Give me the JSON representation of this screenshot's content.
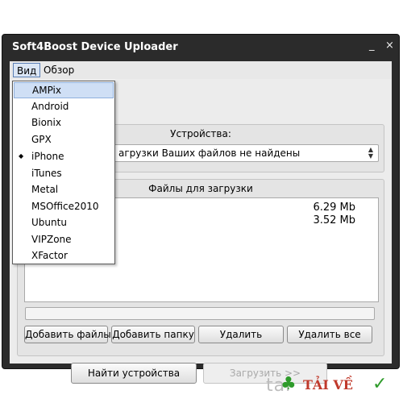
{
  "window": {
    "title": "Soft4Boost Device Uploader",
    "minimize_glyph": "_",
    "close_glyph": "×"
  },
  "menubar": {
    "items": [
      {
        "label": "Вид",
        "active": true
      },
      {
        "label": "Обзор",
        "active": false
      }
    ]
  },
  "devices_panel": {
    "header": "Устройства:",
    "select_value": "агрузки Ваших файлов не найдены"
  },
  "files_panel": {
    "header": "Файлы для загрузки",
    "file_sizes": [
      "6.29 Mb",
      "3.52 Mb"
    ],
    "progress": 0
  },
  "buttons": {
    "add_files": "Добавить файлы",
    "add_folder": "Добавить папку",
    "delete": "Удалить",
    "delete_all": "Удалить все",
    "find_devices": "Найти устройства",
    "upload": "Загрузить >>"
  },
  "view_menu": {
    "items": [
      "AMPix",
      "Android",
      "Bionix",
      "GPX",
      "iPhone",
      "iTunes",
      "Metal",
      "MSOffice2010",
      "Ubuntu",
      "VIPZone",
      "XFactor"
    ],
    "hovered": "AMPix",
    "checked": "iPhone",
    "check_glyph": "◆"
  },
  "watermark": {
    "prefix": "tai",
    "brand": "TẢI VỀ",
    "clover_icon": "clover-icon",
    "check_icon": "checkmark-icon"
  },
  "colors": {
    "titlebar": "#2b2b2b",
    "client": "#ececec",
    "menu_highlight": "#cfdff5",
    "brand_red": "#c0392b",
    "brand_green": "#2e9b2a"
  }
}
